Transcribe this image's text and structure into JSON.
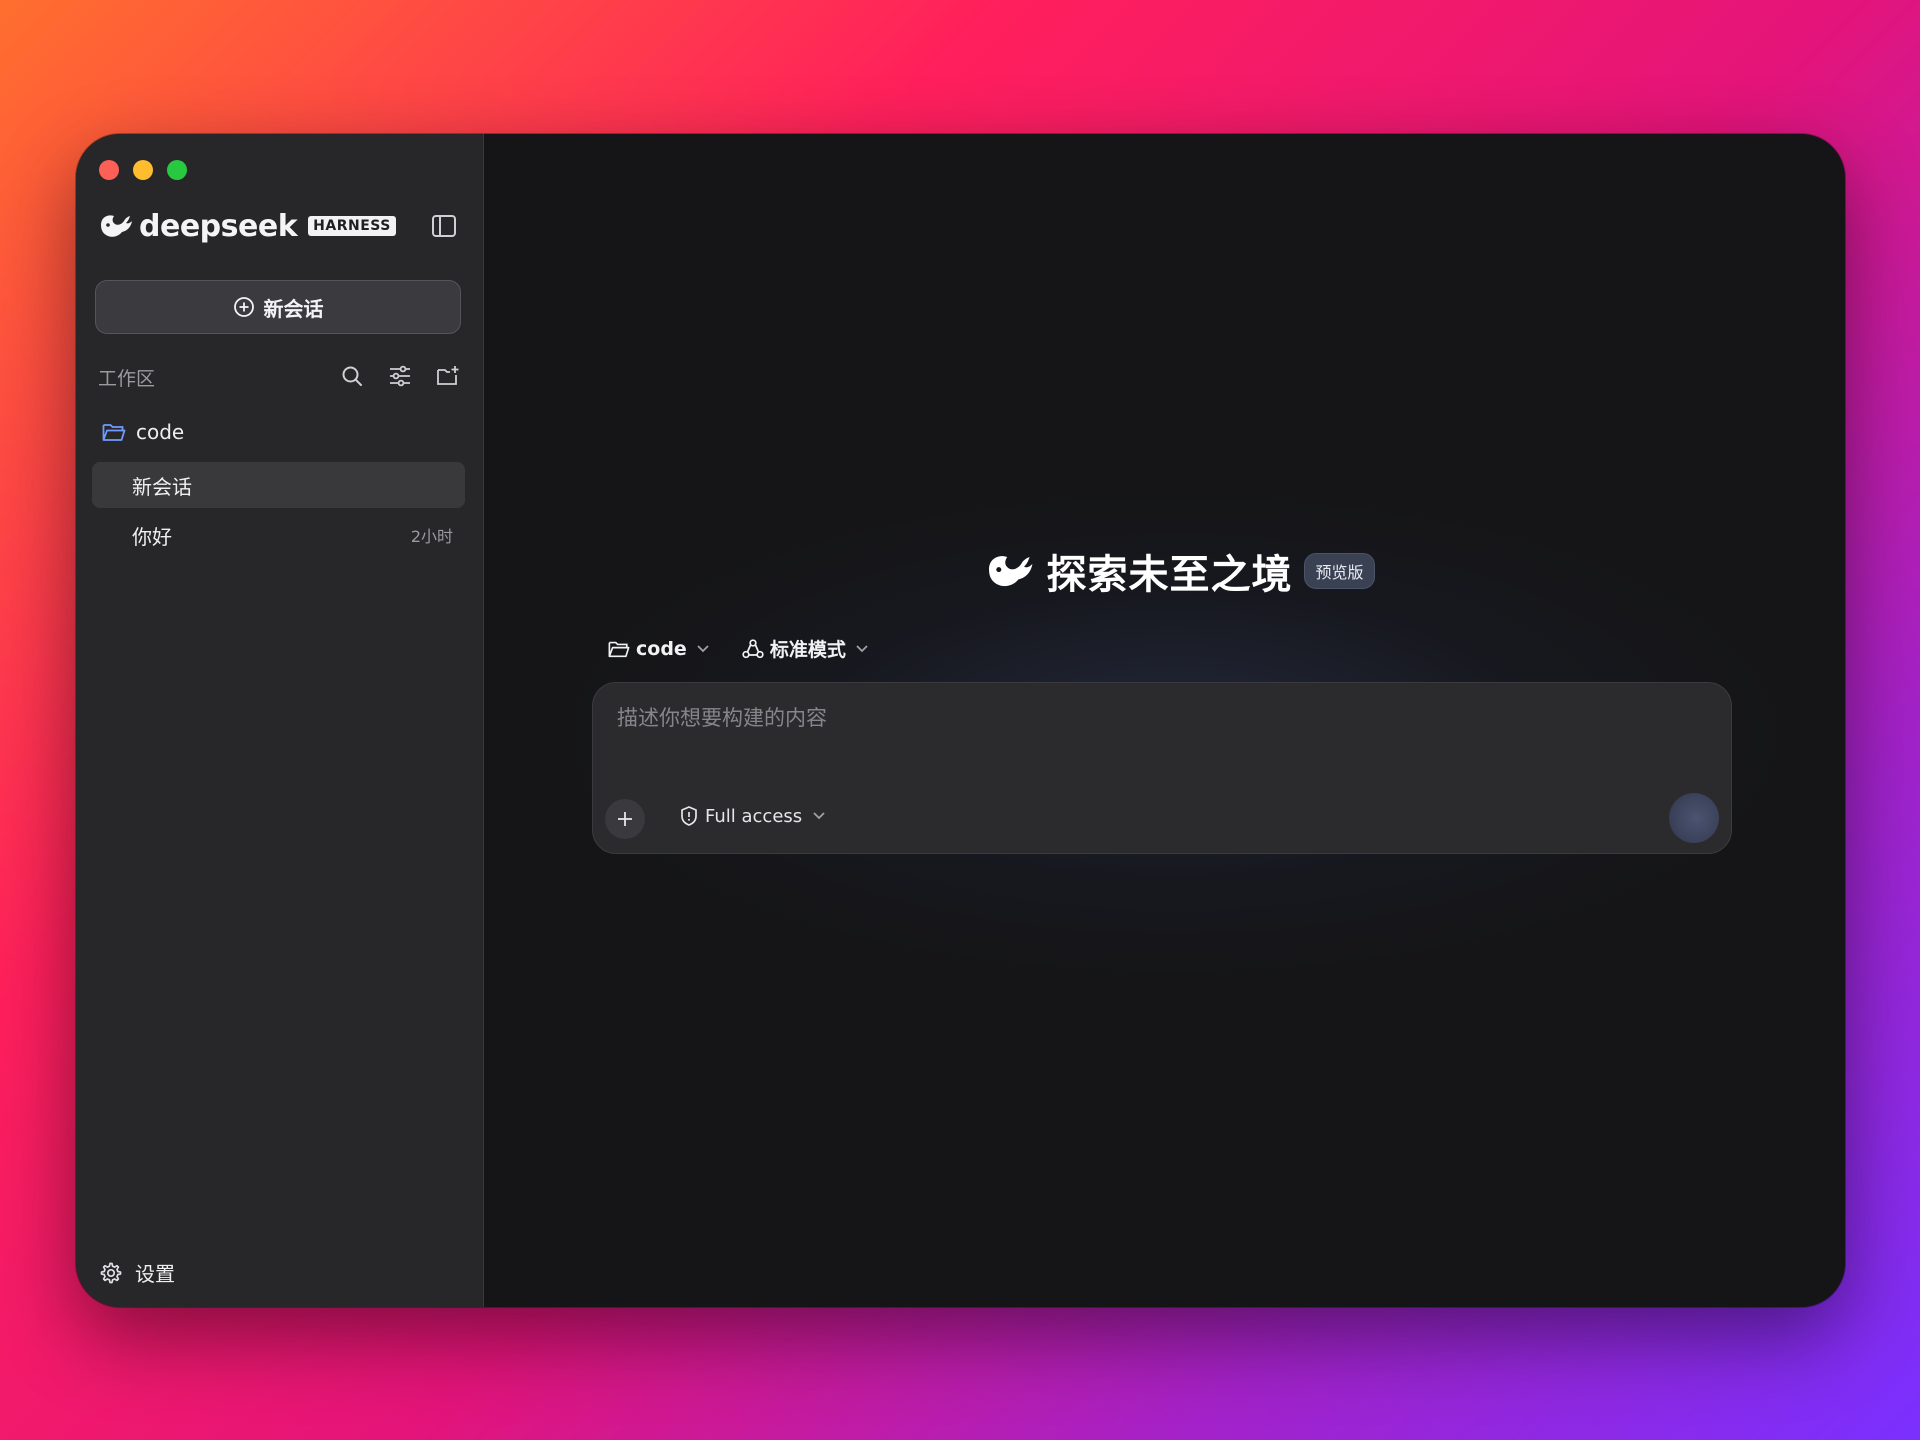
{
  "sidebar": {
    "brand_name": "deepseek",
    "brand_badge": "HARNESS",
    "new_chat_label": "新会话",
    "workspace_label": "工作区",
    "folder_name": "code",
    "conversations": [
      {
        "title": "新会话",
        "time": "",
        "active": true
      },
      {
        "title": "你好",
        "time": "2小时",
        "active": false
      }
    ],
    "settings_label": "设置"
  },
  "main": {
    "hero_title": "探索未至之境",
    "hero_badge": "预览版",
    "folder_picker": "code",
    "mode_picker": "标准模式",
    "composer_placeholder": "描述你想要构建的内容",
    "access_label": "Full access"
  },
  "icons": {
    "logo": "whale-icon",
    "toggle": "sidebar-toggle-icon",
    "search": "search-icon",
    "filter": "sliders-icon",
    "new_folder": "folder-plus-icon",
    "settings": "gear-icon",
    "shield": "shield-icon"
  },
  "colors": {
    "sidebar_bg": "#272729",
    "main_bg": "#151517",
    "folder_icon": "#6f9bff",
    "badge_bg": "#3a4152"
  }
}
